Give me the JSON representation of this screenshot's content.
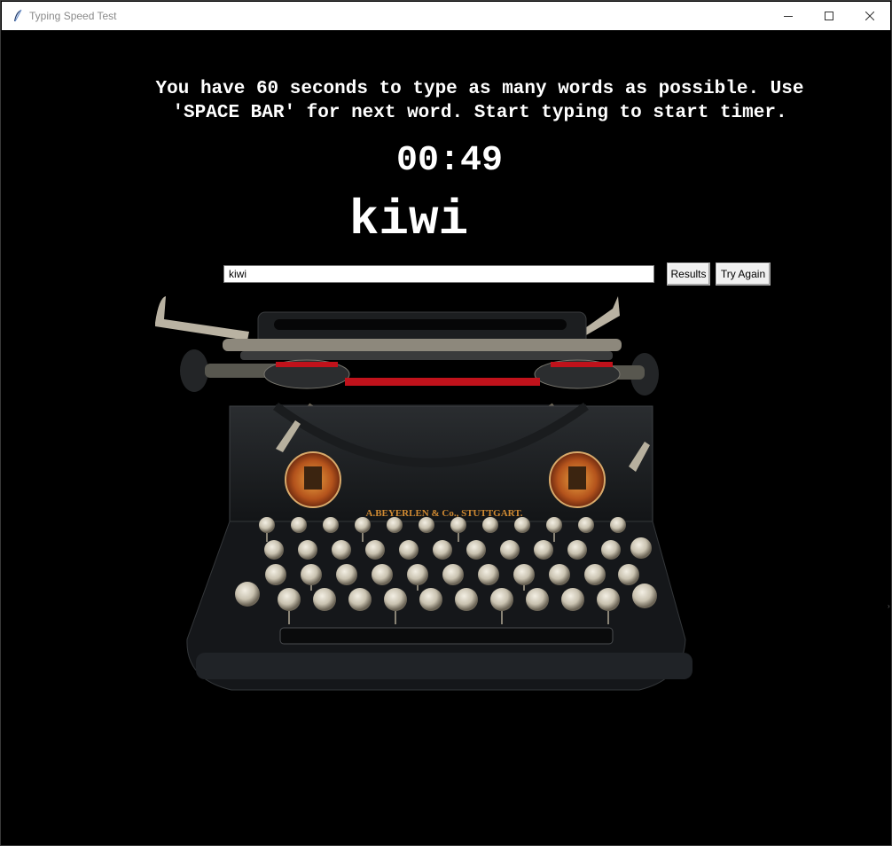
{
  "window": {
    "title": "Typing Speed Test",
    "controls": [
      "minimize-icon",
      "maximize-icon",
      "close-icon"
    ]
  },
  "app": {
    "instructions": "You have 60 seconds to type as many words as possible. Use\n'SPACE BAR' for next word. Start typing to start timer.",
    "timer": "00:49",
    "current_word": "kiwi",
    "entry_value": "kiwi",
    "results_label": "Results",
    "try_again_label": "Try Again",
    "typewriter_brand": "A.BEYERLEN & Co., STUTTGART."
  },
  "colors": {
    "background": "#000000",
    "text": "#ffffff",
    "ribbon_red": "#c0121b",
    "emblem_orange": "#c9631f"
  }
}
